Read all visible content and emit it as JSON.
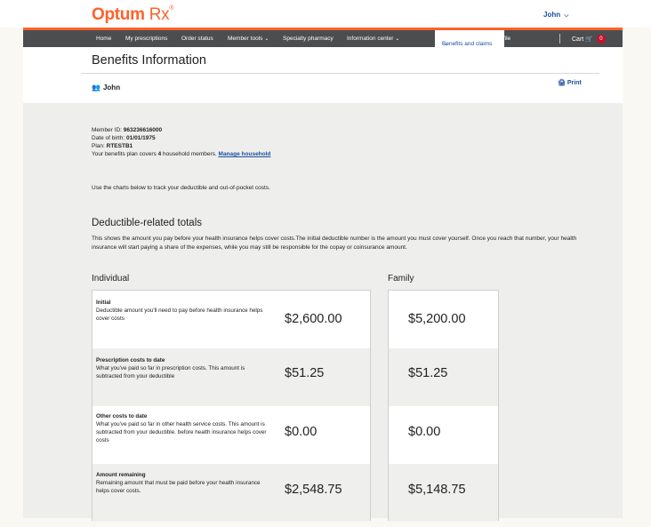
{
  "header": {
    "logo_brand": "Optum",
    "logo_product": "Rx",
    "logo_mark": "®",
    "user_menu": "John",
    "chevron": "⌄"
  },
  "nav": {
    "items": [
      "Home",
      "My prescriptions",
      "Order status",
      "Member tools",
      "Specialty pharmacy",
      "Information center",
      "Benefits and claims",
      "My profile"
    ],
    "cart_label": "Cart",
    "cart_count": "0"
  },
  "page": {
    "title": "Benefits Information",
    "member_name": "John",
    "print_label": "Print"
  },
  "member": {
    "id_label": "Member ID:",
    "id_value": "963236616000",
    "dob_label": "Date of birth:",
    "dob_value": "01/01/1975",
    "plan_label": "Plan:",
    "plan_value": "RTESTB1",
    "household_prefix": "Your benefits plan covers",
    "household_count": "4",
    "household_suffix": "household members.",
    "manage_link": "Manage household",
    "instructions": "Use the charts below to track your deductible and out-of-pocket costs."
  },
  "deductible": {
    "title": "Deductible-related totals",
    "description": "This shows the amount you pay before your health insurance helps cover costs.The initial deductible number is the amount you must cover yourself. Once you reach that number, your health insurance will start paying a share of the expenses, while you may still be responsible for the copay or coinsurance amount.",
    "individual_heading": "Individual",
    "family_heading": "Family",
    "rows": [
      {
        "title": "Initial",
        "text": "Deductible amount you'll need to pay before health insurance helps cover costs",
        "individual": "$2,600.00",
        "family": "$5,200.00"
      },
      {
        "title": "Prescription costs to date",
        "text": "What you've paid so far in prescription costs. This amount is subtracted from your deductible",
        "individual": "$51.25",
        "family": "$51.25"
      },
      {
        "title": "Other costs to date",
        "text": "What you've paid so far in other health service costs. This amount is subtracted from your deductible. before health insurance helps cover costs",
        "individual": "$0.00",
        "family": "$0.00"
      },
      {
        "title": "Amount remaining",
        "text": "Remaining amount that must be paid before your health insurance helps cover costs.",
        "individual": "$2,548.75",
        "family": "$5,148.75"
      }
    ]
  },
  "icons": {
    "person": "person-icon",
    "print": "printer-icon",
    "cart": "cart-icon"
  }
}
